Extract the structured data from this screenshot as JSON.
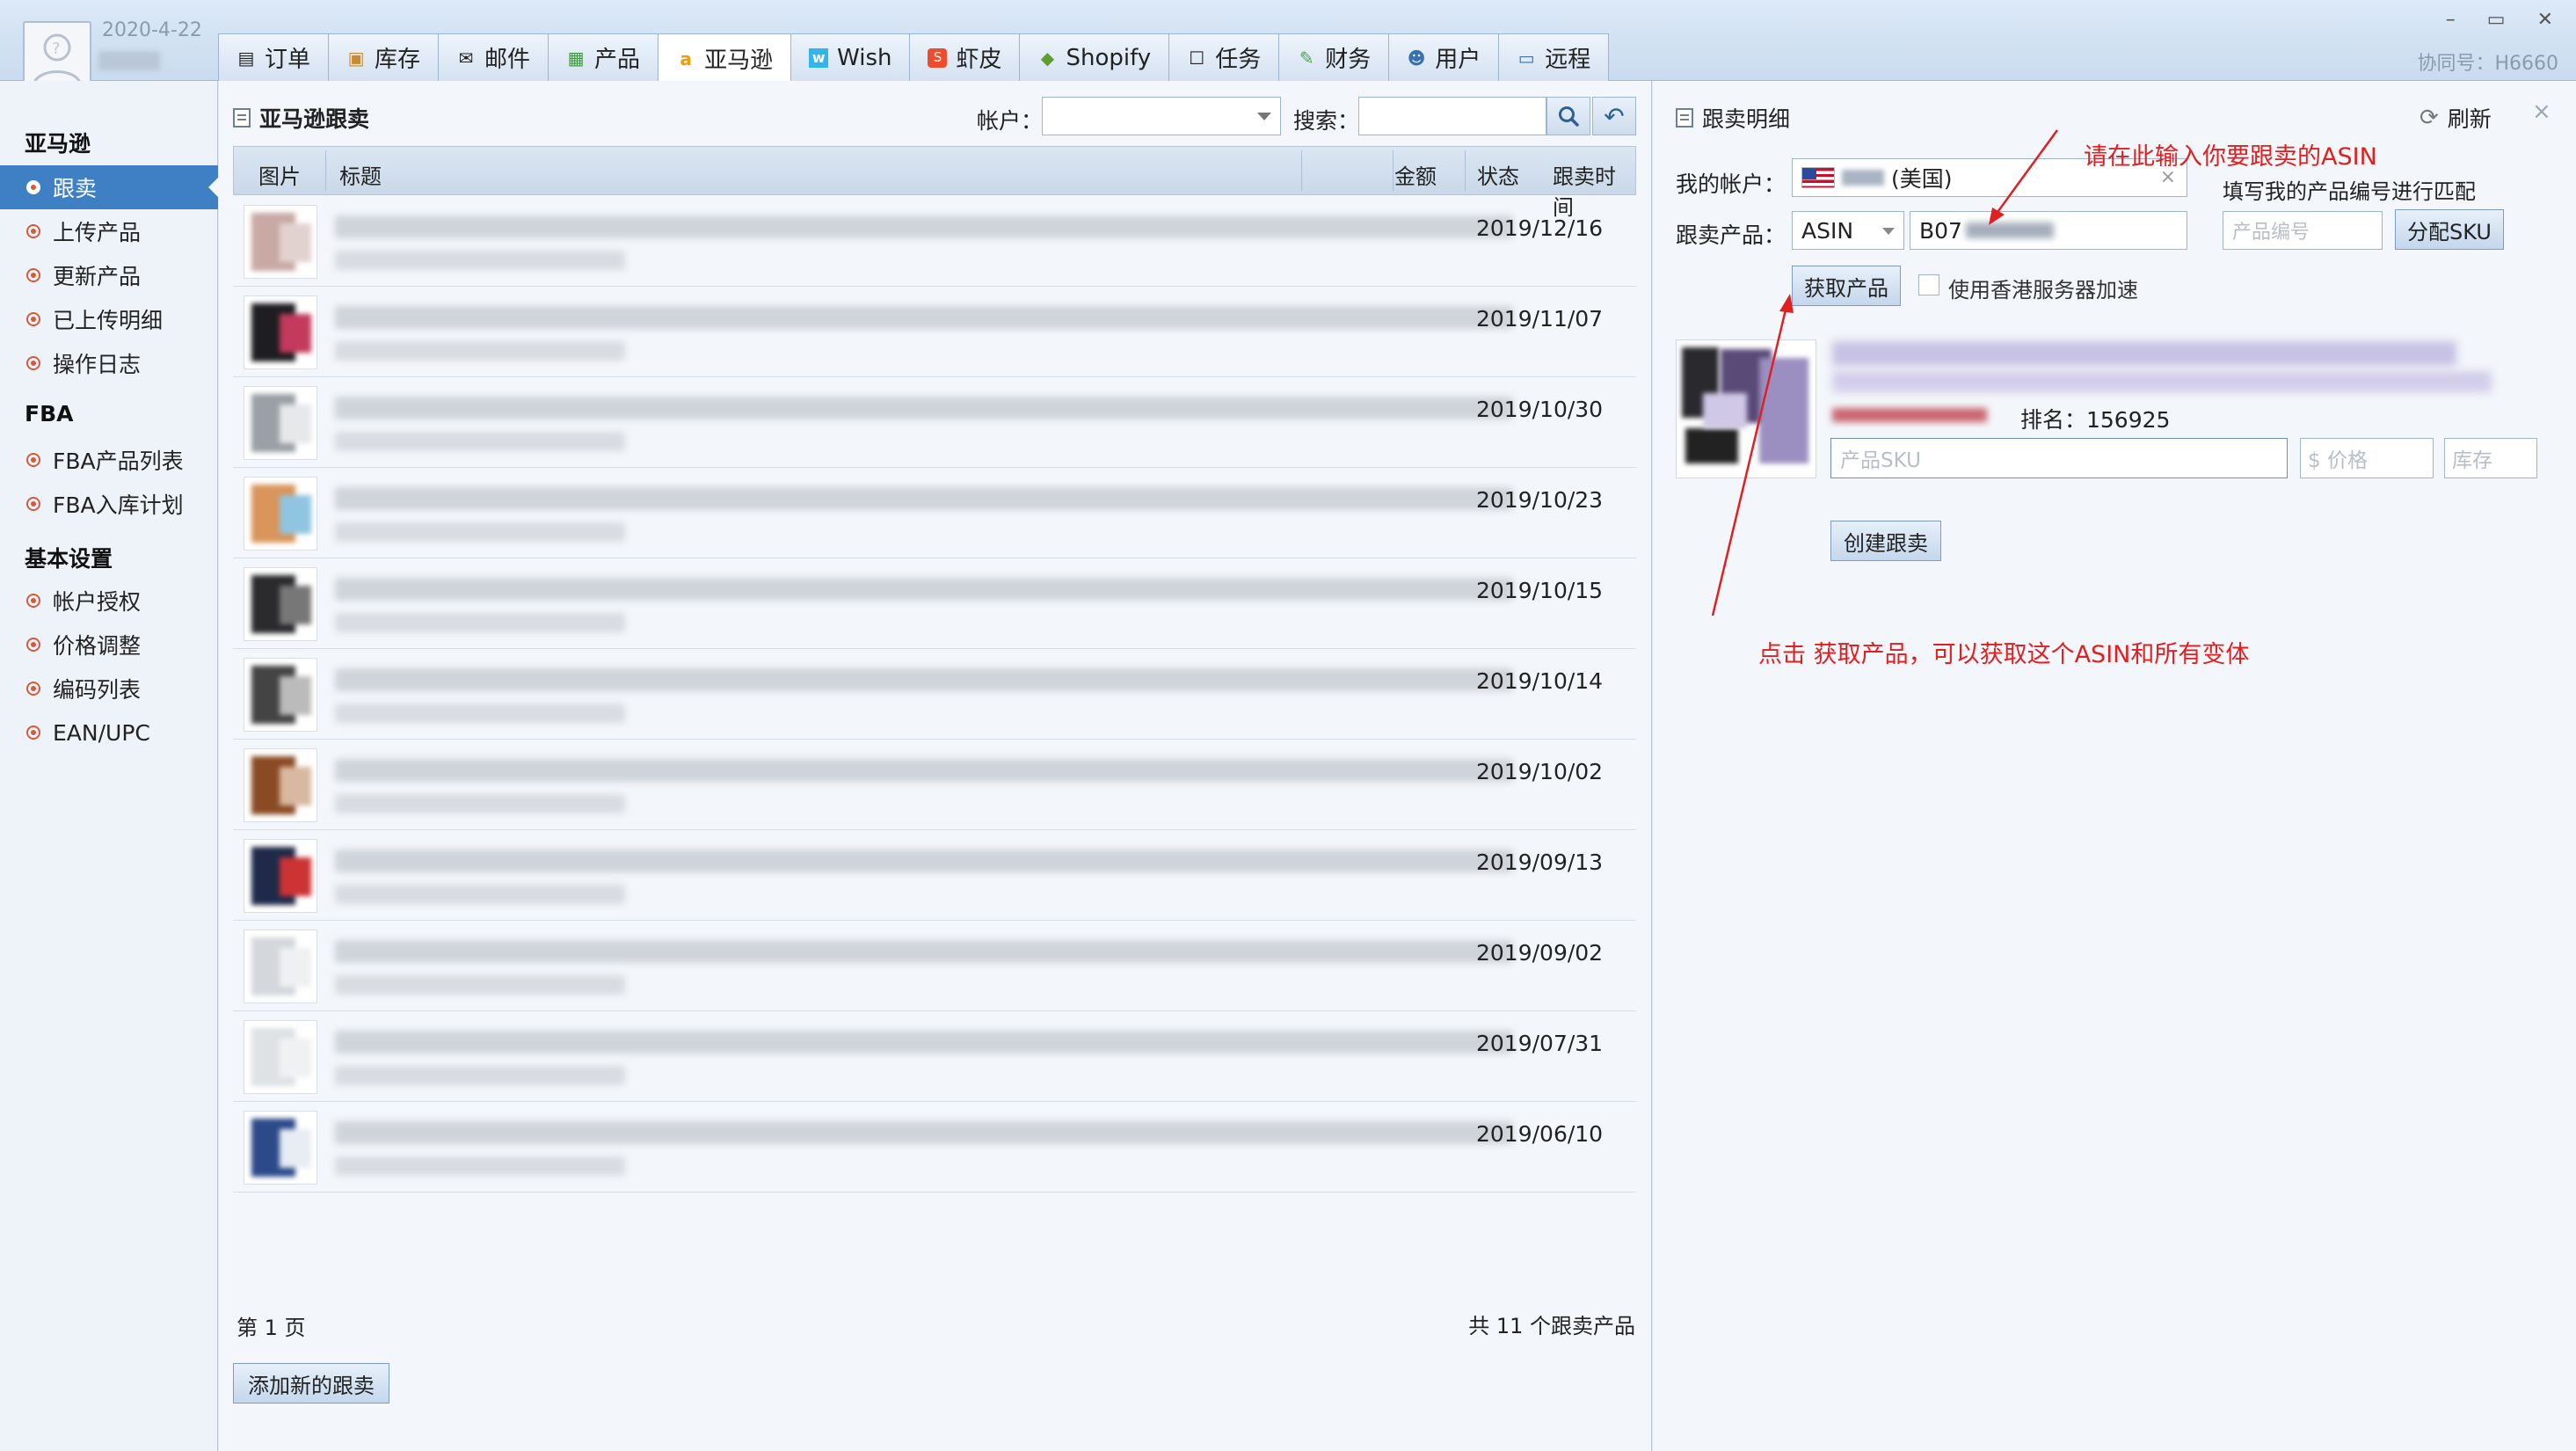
{
  "header": {
    "date": "2020-4-22",
    "coop_id": "协同号：H6660",
    "window_controls": [
      "–",
      "▭",
      "✕"
    ],
    "tabs": [
      {
        "label": "订单",
        "icon": "doc-icon"
      },
      {
        "label": "库存",
        "icon": "box-icon"
      },
      {
        "label": "邮件",
        "icon": "mail-icon"
      },
      {
        "label": "产品",
        "icon": "grid-icon"
      },
      {
        "label": "亚马逊",
        "icon": "amazon-icon",
        "active": true
      },
      {
        "label": "Wish",
        "icon": "wish-icon"
      },
      {
        "label": "虾皮",
        "icon": "shopee-icon"
      },
      {
        "label": "Shopify",
        "icon": "shopify-icon"
      },
      {
        "label": "任务",
        "icon": "task-icon"
      },
      {
        "label": "财务",
        "icon": "finance-icon"
      },
      {
        "label": "用户",
        "icon": "user-icon"
      },
      {
        "label": "远程",
        "icon": "remote-icon"
      }
    ]
  },
  "sidebar": {
    "groups": [
      {
        "title": "亚马逊",
        "items": [
          "跟卖",
          "上传产品",
          "更新产品",
          "已上传明细",
          "操作日志"
        ]
      },
      {
        "title": "FBA",
        "items": [
          "FBA产品列表",
          "FBA入库计划"
        ]
      },
      {
        "title": "基本设置",
        "items": [
          "帐户授权",
          "价格调整",
          "编码列表",
          "EAN/UPC"
        ]
      }
    ],
    "active_item": "跟卖"
  },
  "main": {
    "title": "亚马逊跟卖",
    "account_label": "帐户：",
    "search_label": "搜索：",
    "columns": [
      "图片",
      "标题",
      "金额",
      "状态",
      "跟卖时间"
    ],
    "rows": [
      {
        "date": "2019/12/16"
      },
      {
        "date": "2019/11/07"
      },
      {
        "date": "2019/10/30"
      },
      {
        "date": "2019/10/23"
      },
      {
        "date": "2019/10/15"
      },
      {
        "date": "2019/10/14"
      },
      {
        "date": "2019/10/02"
      },
      {
        "date": "2019/09/13"
      },
      {
        "date": "2019/09/02"
      },
      {
        "date": "2019/07/31"
      },
      {
        "date": "2019/06/10"
      }
    ],
    "page_info": "第 1 页",
    "total_info": "共 11 个跟卖产品",
    "add_button": "添加新的跟卖"
  },
  "right": {
    "title": "跟卖明细",
    "refresh": "刷新",
    "my_account_label": "我的帐户：",
    "my_account_value": "(美国)",
    "follow_product_label": "跟卖产品：",
    "follow_type": "ASIN",
    "asin_prefix": "B07",
    "match_hint": "填写我的产品编号进行匹配",
    "product_code_placeholder": "产品编号",
    "assign_sku": "分配SKU",
    "fetch_button": "获取产品",
    "hk_label": "使用香港服务器加速",
    "rank": "排名：156925",
    "sku_placeholder": "产品SKU",
    "price_placeholder": "$ 价格",
    "stock_placeholder": "库存",
    "create_button": "创建跟卖"
  },
  "annotations": {
    "top": "请在此输入你要跟卖的ASIN",
    "bottom": "点击 获取产品，可以获取这个ASIN和所有变体",
    "color": "#e02020"
  }
}
